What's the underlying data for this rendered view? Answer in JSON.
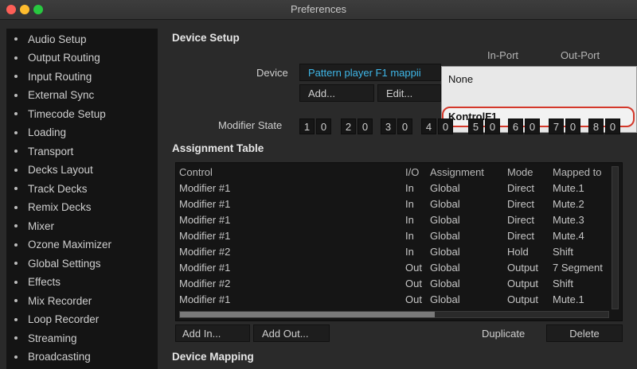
{
  "window": {
    "title": "Preferences"
  },
  "sidebar": {
    "items": [
      {
        "label": "Audio Setup"
      },
      {
        "label": "Output Routing"
      },
      {
        "label": "Input Routing"
      },
      {
        "label": "External Sync"
      },
      {
        "label": "Timecode Setup"
      },
      {
        "label": "Loading"
      },
      {
        "label": "Transport"
      },
      {
        "label": "Decks Layout"
      },
      {
        "label": "Track Decks"
      },
      {
        "label": "Remix Decks"
      },
      {
        "label": "Mixer"
      },
      {
        "label": "Ozone Maximizer"
      },
      {
        "label": "Global Settings"
      },
      {
        "label": "Effects"
      },
      {
        "label": "Mix Recorder"
      },
      {
        "label": "Loop Recorder"
      },
      {
        "label": "Streaming"
      },
      {
        "label": "Broadcasting"
      }
    ]
  },
  "device_setup": {
    "title": "Device Setup",
    "device_label": "Device",
    "device_value": "Pattern player F1 mappii",
    "in_port_label": "In-Port",
    "out_port_label": "Out-Port",
    "add_label": "Add...",
    "edit_label": "Edit...",
    "dropdown_options": [
      "None",
      "KontrolF1"
    ],
    "selected_option": "KontrolF1",
    "modifier_label": "Modifier State",
    "modifier_values": [
      "1",
      "0",
      "2",
      "0",
      "3",
      "0",
      "4",
      "0",
      "5",
      "0",
      "6",
      "0",
      "7",
      "0",
      "8",
      "0"
    ]
  },
  "assignment_table": {
    "title": "Assignment Table",
    "columns": [
      "Control",
      "I/O",
      "Assignment",
      "Mode",
      "Mapped to"
    ],
    "rows": [
      [
        "Modifier #1",
        "In",
        "Global",
        "Direct",
        "Mute.1"
      ],
      [
        "Modifier #1",
        "In",
        "Global",
        "Direct",
        "Mute.2"
      ],
      [
        "Modifier #1",
        "In",
        "Global",
        "Direct",
        "Mute.3"
      ],
      [
        "Modifier #1",
        "In",
        "Global",
        "Direct",
        "Mute.4"
      ],
      [
        "Modifier #2",
        "In",
        "Global",
        "Hold",
        "Shift"
      ],
      [
        "Modifier #1",
        "Out",
        "Global",
        "Output",
        "7 Segment"
      ],
      [
        "Modifier #2",
        "Out",
        "Global",
        "Output",
        "Shift"
      ],
      [
        "Modifier #1",
        "Out",
        "Global",
        "Output",
        "Mute.1"
      ]
    ],
    "add_in_label": "Add In...",
    "add_out_label": "Add Out...",
    "duplicate_label": "Duplicate",
    "delete_label": "Delete"
  },
  "device_mapping": {
    "title": "Device Mapping"
  }
}
